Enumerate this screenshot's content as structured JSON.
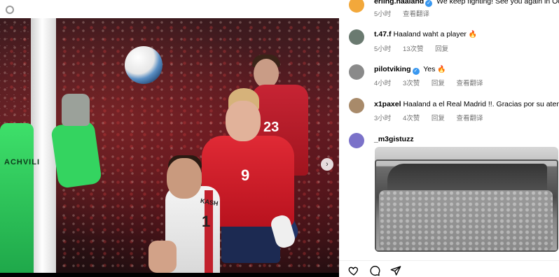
{
  "comments": [
    {
      "user": "erling.haaland",
      "verified": true,
      "text": "We keep fighting! See you again in Oct",
      "time": "5小时",
      "actions": [
        "查看翻译"
      ],
      "avatar_color": "#f2a83b"
    },
    {
      "user": "t.47.f",
      "verified": false,
      "text": "Haaland waht a player",
      "emoji": "🔥",
      "time": "5小时",
      "likes": "13次赞",
      "actions": [
        "回复"
      ],
      "avatar_color": "#6a7a70"
    },
    {
      "user": "pilotviking",
      "verified": true,
      "text": "Yes",
      "emoji": "🔥",
      "time": "4小时",
      "likes": "3次赞",
      "actions": [
        "回复",
        "查看翻译"
      ],
      "avatar_color": "#8a8a8a"
    },
    {
      "user": "x1paxel",
      "verified": false,
      "text": "Haaland a el Real Madrid !!. Gracias por su atenci",
      "time": "3小时",
      "likes": "4次赞",
      "actions": [
        "回复",
        "查看翻译"
      ],
      "avatar_color": "#a88a6a"
    },
    {
      "user": "_m3gistuzz",
      "verified": false,
      "text": "",
      "avatar_color": "#7b72c9"
    }
  ],
  "photo_overlay_text": {
    "keeper_name": "ACHVILI",
    "player_back_number": "23",
    "main_player_number": "9",
    "white_player_name": "KASH",
    "white_player_number": "1"
  },
  "actions": [
    {
      "name": "like",
      "icon": "heart-icon"
    },
    {
      "name": "comment",
      "icon": "comment-icon"
    },
    {
      "name": "share",
      "icon": "send-icon"
    }
  ],
  "colors": {
    "accent": "#3897f0",
    "meta_text": "#737373"
  }
}
